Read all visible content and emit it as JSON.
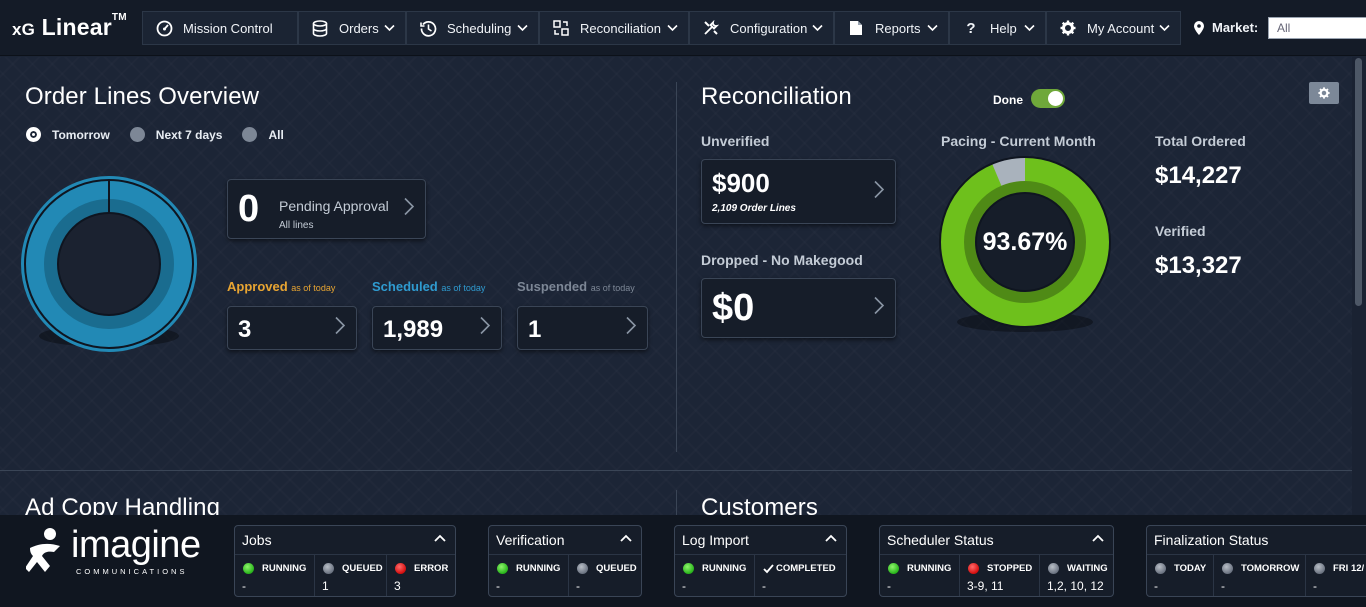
{
  "app": {
    "brand_prefix": "xG",
    "brand_name": "Linear",
    "brand_tm": "TM"
  },
  "nav": {
    "mission_control": "Mission Control",
    "orders": "Orders",
    "scheduling": "Scheduling",
    "reconciliation": "Reconciliation",
    "configuration": "Configuration",
    "reports": "Reports",
    "help": "Help",
    "my_account": "My Account",
    "market_label": "Market:",
    "market_value": "All"
  },
  "order_lines": {
    "title": "Order Lines Overview",
    "filters": [
      {
        "label": "Tomorrow",
        "selected": true
      },
      {
        "label": "Next 7 days",
        "selected": false
      },
      {
        "label": "All",
        "selected": false
      }
    ],
    "donut_color": "#2289b5",
    "pending": {
      "value": "0",
      "label": "Pending Approval",
      "sub": "All lines"
    },
    "approved": {
      "label": "Approved",
      "suffix": "as of today",
      "value": "3",
      "color": "#e8a532"
    },
    "scheduled": {
      "label": "Scheduled",
      "suffix": "as of today",
      "value": "1,989",
      "color": "#2f9bd0"
    },
    "suspended": {
      "label": "Suspended",
      "suffix": "as of today",
      "value": "1",
      "color": "#7d8796"
    }
  },
  "reconciliation": {
    "title": "Reconciliation",
    "done_label": "Done",
    "done_on": true,
    "unverified": {
      "label": "Unverified",
      "value": "$900",
      "sub": "2,109 Order Lines"
    },
    "dropped": {
      "label": "Dropped - No Makegood",
      "value": "$0"
    },
    "pacing": {
      "label": "Pacing - Current Month",
      "value": "93.67%",
      "fraction": 0.9367,
      "color": "#6ec01c"
    },
    "total_ordered": {
      "label": "Total Ordered",
      "value": "$14,227"
    },
    "verified": {
      "label": "Verified",
      "value": "$13,327"
    }
  },
  "sections": {
    "ad_copy": "Ad Copy Handling",
    "customers": "Customers"
  },
  "logo": {
    "word": "imagine",
    "sub": "COMMUNICATIONS"
  },
  "status": {
    "jobs": {
      "title": "Jobs",
      "cells": [
        {
          "status": "green",
          "label": "RUNNING",
          "value": "-"
        },
        {
          "status": "grey",
          "label": "QUEUED",
          "value": "1"
        },
        {
          "status": "red",
          "label": "ERROR",
          "value": "3"
        }
      ]
    },
    "verification": {
      "title": "Verification",
      "cells": [
        {
          "status": "green",
          "label": "RUNNING",
          "value": "-"
        },
        {
          "status": "grey",
          "label": "QUEUED",
          "value": "-"
        }
      ]
    },
    "log_import": {
      "title": "Log Import",
      "cells": [
        {
          "status": "green",
          "label": "RUNNING",
          "value": "-"
        },
        {
          "status": "check",
          "label": "COMPLETED",
          "value": "-"
        }
      ]
    },
    "scheduler": {
      "title": "Scheduler Status",
      "cells": [
        {
          "status": "green",
          "label": "RUNNING",
          "value": "-"
        },
        {
          "status": "red",
          "label": "STOPPED",
          "value": "3-9, 11"
        },
        {
          "status": "grey",
          "label": "WAITING",
          "value": "1,2, 10, 12"
        }
      ]
    },
    "finalization": {
      "title": "Finalization Status",
      "cells": [
        {
          "status": "grey",
          "label": "TODAY",
          "value": "-"
        },
        {
          "status": "grey",
          "label": "TOMORROW",
          "value": "-"
        },
        {
          "status": "grey",
          "label": "FRI 12/",
          "value": "-"
        }
      ]
    }
  }
}
